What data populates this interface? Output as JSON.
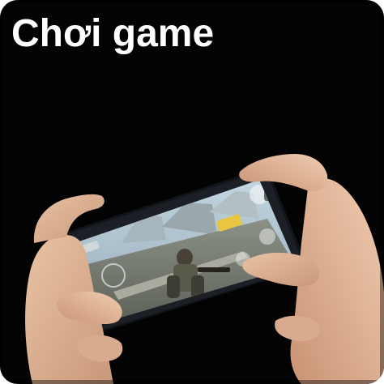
{
  "tile": {
    "title": "Chơi game"
  },
  "scene": {
    "subject": "hands-holding-phone",
    "phone_screen": "game-screen",
    "background_color": "#030303"
  }
}
